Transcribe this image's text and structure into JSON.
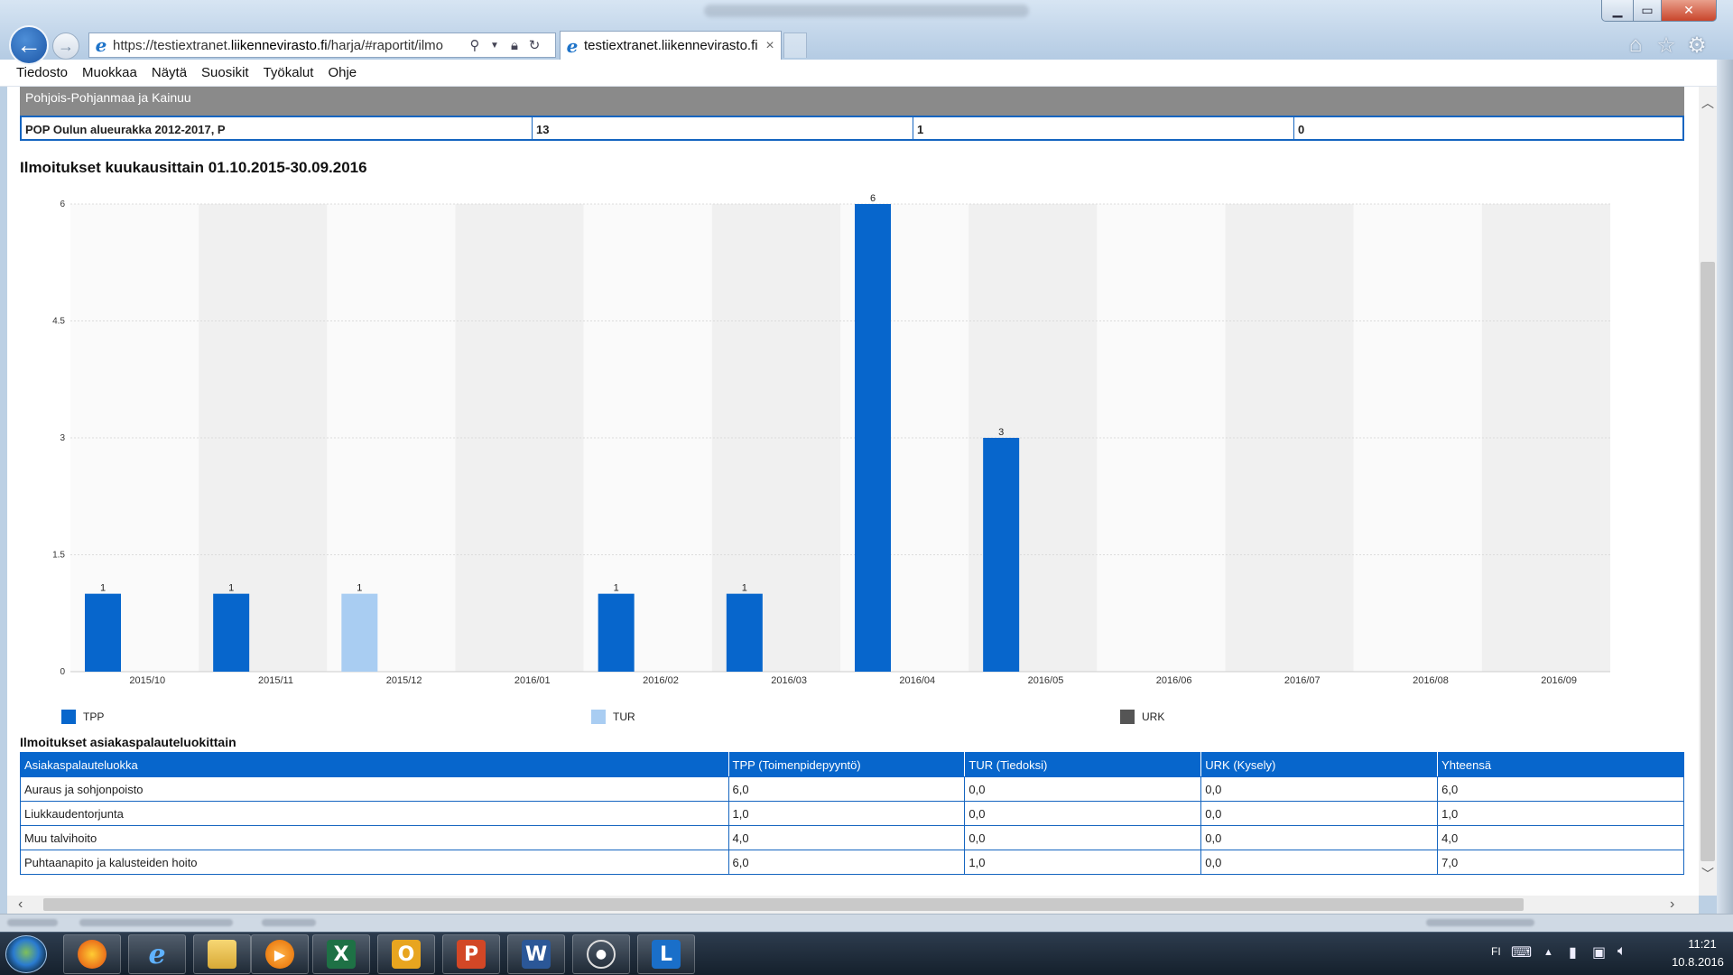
{
  "browser": {
    "address_url_prefix": "https://testiextranet.",
    "address_url_domain": "liikennevirasto.fi",
    "address_url_path": "/harja/#raportit/ilmo",
    "tab_title": "testiextranet.liikennevirasto.fi",
    "tab_close": "×",
    "menu": [
      "Tiedosto",
      "Muokkaa",
      "Näytä",
      "Suosikit",
      "Työkalut",
      "Ohje"
    ]
  },
  "page": {
    "region_name": "Pohjois-Pohjanmaa ja Kainuu",
    "summary": [
      "POP Oulun alueurakka 2012-2017, P",
      "13",
      "1",
      "0"
    ],
    "chart_title": "Ilmoitukset kuukausittain 01.10.2015-30.09.2016",
    "table_title": "Ilmoitukset asiakaspalauteluokittain",
    "table": {
      "headers": [
        "Asiakaspalauteluokka",
        "TPP (Toimenpidepyyntö)",
        "TUR (Tiedoksi)",
        "URK (Kysely)",
        "Yhteensä"
      ],
      "rows": [
        [
          "Auraus ja sohjonpoisto",
          "6,0",
          "0,0",
          "0,0",
          "6,0"
        ],
        [
          "Liukkaudentorjunta",
          "1,0",
          "0,0",
          "0,0",
          "1,0"
        ],
        [
          "Muu talvihoito",
          "4,0",
          "0,0",
          "0,0",
          "4,0"
        ],
        [
          "Puhtaanapito ja kalusteiden hoito",
          "6,0",
          "1,0",
          "0,0",
          "7,0"
        ]
      ]
    }
  },
  "chart_data": {
    "type": "bar",
    "title": "Ilmoitukset kuukausittain 01.10.2015-30.09.2016",
    "categories": [
      "2015/10",
      "2015/11",
      "2015/12",
      "2016/01",
      "2016/02",
      "2016/03",
      "2016/04",
      "2016/05",
      "2016/06",
      "2016/07",
      "2016/08",
      "2016/09"
    ],
    "series": [
      {
        "name": "TPP",
        "color": "#0766cc",
        "values": [
          1,
          1,
          0,
          0,
          1,
          1,
          6,
          3,
          0,
          0,
          0,
          0
        ]
      },
      {
        "name": "TUR",
        "color": "#a9cdf2",
        "values": [
          0,
          0,
          1,
          0,
          0,
          0,
          0,
          0,
          0,
          0,
          0,
          0
        ]
      },
      {
        "name": "URK",
        "color": "#555555",
        "values": [
          0,
          0,
          0,
          0,
          0,
          0,
          0,
          0,
          0,
          0,
          0,
          0
        ]
      }
    ],
    "yticks": [
      "0",
      "1.5",
      "3",
      "4.5",
      "6"
    ],
    "ylim": [
      0,
      6
    ],
    "grid": true,
    "legend": "bottom"
  },
  "taskbar": {
    "language": "FI",
    "time": "11:21",
    "date": "10.8.2016"
  }
}
